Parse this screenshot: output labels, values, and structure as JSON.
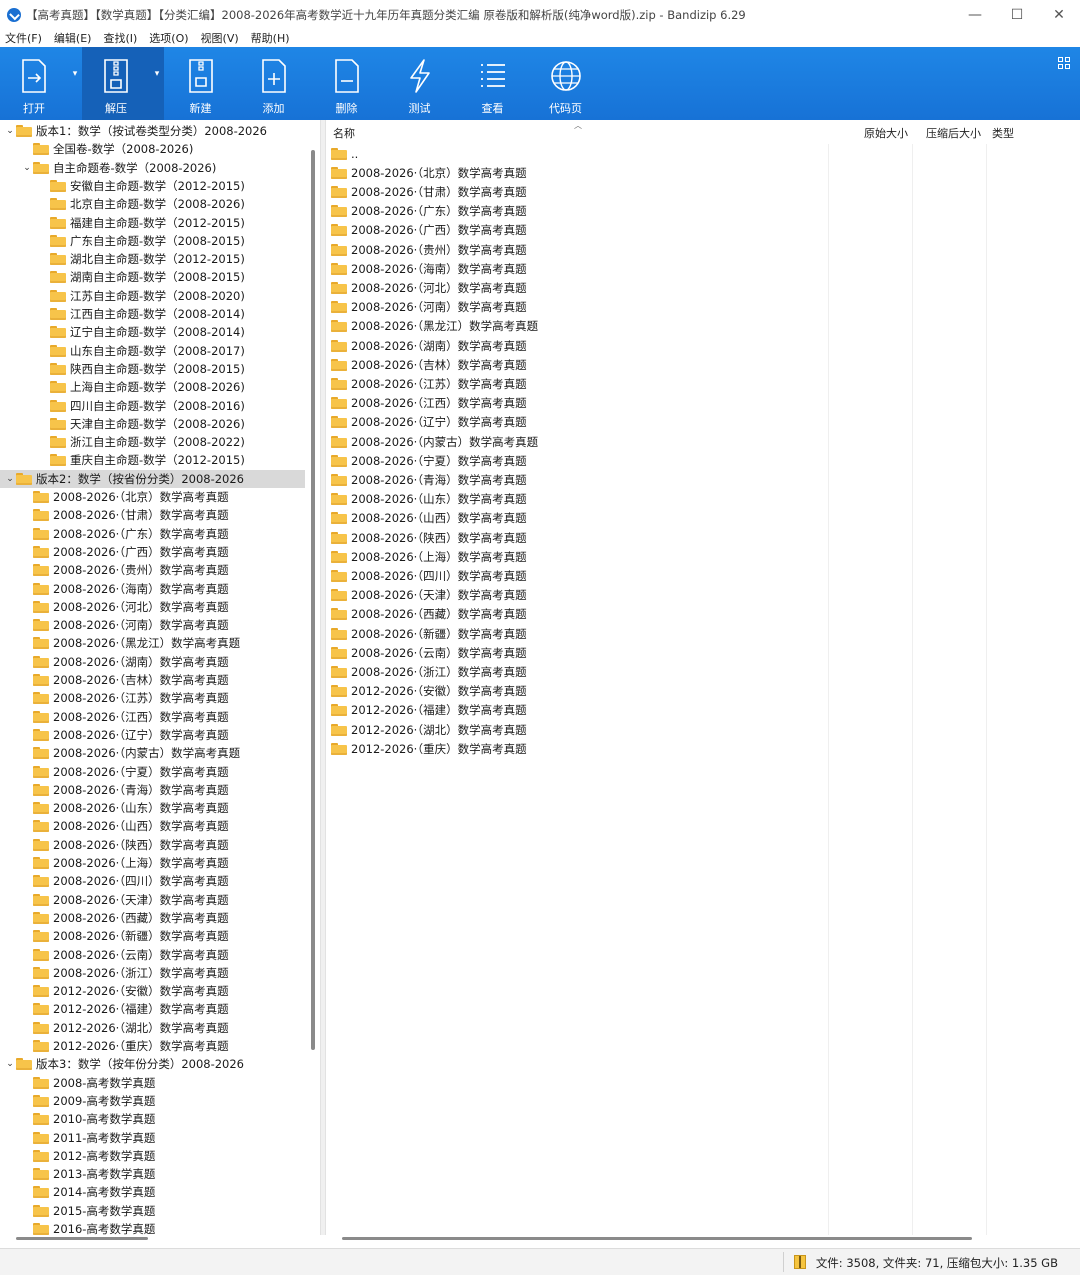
{
  "window": {
    "title": "【高考真题】【数学真题】【分类汇编】2008-2026年高考数学近十九年历年真题分类汇编   原卷版和解析版(纯净word版).zip - Bandizip 6.29",
    "minimize": "—",
    "maximize": "☐",
    "close": "✕"
  },
  "menu": [
    "文件(F)",
    "编辑(E)",
    "查找(I)",
    "选项(O)",
    "视图(V)",
    "帮助(H)"
  ],
  "toolbar": {
    "open": "打开",
    "extract": "解压",
    "new": "新建",
    "add": "添加",
    "delete": "删除",
    "test": "测试",
    "view": "查看",
    "codepage": "代码页"
  },
  "tree": [
    {
      "level": 0,
      "twisty": "expanded",
      "label": "版本1：数学（按试卷类型分类）2008-2026"
    },
    {
      "level": 1,
      "twisty": "none",
      "label": "全国卷-数学（2008-2026)"
    },
    {
      "level": 1,
      "twisty": "expanded",
      "label": "自主命题卷-数学（2008-2026)"
    },
    {
      "level": 2,
      "twisty": "none",
      "label": "安徽自主命题-数学（2012-2015)"
    },
    {
      "level": 2,
      "twisty": "none",
      "label": "北京自主命题-数学（2008-2026)"
    },
    {
      "level": 2,
      "twisty": "none",
      "label": "福建自主命题-数学（2012-2015)"
    },
    {
      "level": 2,
      "twisty": "none",
      "label": "广东自主命题-数学（2008-2015)"
    },
    {
      "level": 2,
      "twisty": "none",
      "label": "湖北自主命题-数学（2012-2015)"
    },
    {
      "level": 2,
      "twisty": "none",
      "label": "湖南自主命题-数学（2008-2015)"
    },
    {
      "level": 2,
      "twisty": "none",
      "label": "江苏自主命题-数学（2008-2020)"
    },
    {
      "level": 2,
      "twisty": "none",
      "label": "江西自主命题-数学（2008-2014)"
    },
    {
      "level": 2,
      "twisty": "none",
      "label": "辽宁自主命题-数学（2008-2014)"
    },
    {
      "level": 2,
      "twisty": "none",
      "label": "山东自主命题-数学（2008-2017)"
    },
    {
      "level": 2,
      "twisty": "none",
      "label": "陕西自主命题-数学（2008-2015)"
    },
    {
      "level": 2,
      "twisty": "none",
      "label": "上海自主命题-数学（2008-2026)"
    },
    {
      "level": 2,
      "twisty": "none",
      "label": "四川自主命题-数学（2008-2016)"
    },
    {
      "level": 2,
      "twisty": "none",
      "label": "天津自主命题-数学（2008-2026)"
    },
    {
      "level": 2,
      "twisty": "none",
      "label": "浙江自主命题-数学（2008-2022)"
    },
    {
      "level": 2,
      "twisty": "none",
      "label": "重庆自主命题-数学（2012-2015)"
    },
    {
      "level": 0,
      "twisty": "expanded",
      "label": "版本2：数学（按省份分类）2008-2026",
      "selected": true
    },
    {
      "level": 1,
      "twisty": "none",
      "label": "2008-2026·（北京）数学高考真题"
    },
    {
      "level": 1,
      "twisty": "none",
      "label": "2008-2026·（甘肃）数学高考真题"
    },
    {
      "level": 1,
      "twisty": "none",
      "label": "2008-2026·（广东）数学高考真题"
    },
    {
      "level": 1,
      "twisty": "none",
      "label": "2008-2026·（广西）数学高考真题"
    },
    {
      "level": 1,
      "twisty": "none",
      "label": "2008-2026·（贵州）数学高考真题"
    },
    {
      "level": 1,
      "twisty": "none",
      "label": "2008-2026·（海南）数学高考真题"
    },
    {
      "level": 1,
      "twisty": "none",
      "label": "2008-2026·（河北）数学高考真题"
    },
    {
      "level": 1,
      "twisty": "none",
      "label": "2008-2026·（河南）数学高考真题"
    },
    {
      "level": 1,
      "twisty": "none",
      "label": "2008-2026·（黑龙江）数学高考真题"
    },
    {
      "level": 1,
      "twisty": "none",
      "label": "2008-2026·（湖南）数学高考真题"
    },
    {
      "level": 1,
      "twisty": "none",
      "label": "2008-2026·（吉林）数学高考真题"
    },
    {
      "level": 1,
      "twisty": "none",
      "label": "2008-2026·（江苏）数学高考真题"
    },
    {
      "level": 1,
      "twisty": "none",
      "label": "2008-2026·（江西）数学高考真题"
    },
    {
      "level": 1,
      "twisty": "none",
      "label": "2008-2026·（辽宁）数学高考真题"
    },
    {
      "level": 1,
      "twisty": "none",
      "label": "2008-2026·（内蒙古）数学高考真题"
    },
    {
      "level": 1,
      "twisty": "none",
      "label": "2008-2026·（宁夏）数学高考真题"
    },
    {
      "level": 1,
      "twisty": "none",
      "label": "2008-2026·（青海）数学高考真题"
    },
    {
      "level": 1,
      "twisty": "none",
      "label": "2008-2026·（山东）数学高考真题"
    },
    {
      "level": 1,
      "twisty": "none",
      "label": "2008-2026·（山西）数学高考真题"
    },
    {
      "level": 1,
      "twisty": "none",
      "label": "2008-2026·（陕西）数学高考真题"
    },
    {
      "level": 1,
      "twisty": "none",
      "label": "2008-2026·（上海）数学高考真题"
    },
    {
      "level": 1,
      "twisty": "none",
      "label": "2008-2026·（四川）数学高考真题"
    },
    {
      "level": 1,
      "twisty": "none",
      "label": "2008-2026·（天津）数学高考真题"
    },
    {
      "level": 1,
      "twisty": "none",
      "label": "2008-2026·（西藏）数学高考真题"
    },
    {
      "level": 1,
      "twisty": "none",
      "label": "2008-2026·（新疆）数学高考真题"
    },
    {
      "level": 1,
      "twisty": "none",
      "label": "2008-2026·（云南）数学高考真题"
    },
    {
      "level": 1,
      "twisty": "none",
      "label": "2008-2026·（浙江）数学高考真题"
    },
    {
      "level": 1,
      "twisty": "none",
      "label": "2012-2026·（安徽）数学高考真题"
    },
    {
      "level": 1,
      "twisty": "none",
      "label": "2012-2026·（福建）数学高考真题"
    },
    {
      "level": 1,
      "twisty": "none",
      "label": "2012-2026·（湖北）数学高考真题"
    },
    {
      "level": 1,
      "twisty": "none",
      "label": "2012-2026·（重庆）数学高考真题"
    },
    {
      "level": 0,
      "twisty": "expanded",
      "label": "版本3：数学（按年份分类）2008-2026"
    },
    {
      "level": 1,
      "twisty": "none",
      "label": "2008-高考数学真题"
    },
    {
      "level": 1,
      "twisty": "none",
      "label": "2009-高考数学真题"
    },
    {
      "level": 1,
      "twisty": "none",
      "label": "2010-高考数学真题"
    },
    {
      "level": 1,
      "twisty": "none",
      "label": "2011-高考数学真题"
    },
    {
      "level": 1,
      "twisty": "none",
      "label": "2012-高考数学真题"
    },
    {
      "level": 1,
      "twisty": "none",
      "label": "2013-高考数学真题"
    },
    {
      "level": 1,
      "twisty": "none",
      "label": "2014-高考数学真题"
    },
    {
      "level": 1,
      "twisty": "none",
      "label": "2015-高考数学真题"
    },
    {
      "level": 1,
      "twisty": "none",
      "label": "2016-高考数学真题"
    }
  ],
  "list": {
    "columns": {
      "name": "名称",
      "original_size": "原始大小",
      "compressed_size": "压缩后大小",
      "type": "类型"
    },
    "items": [
      "..",
      "2008-2026·（北京）数学高考真题",
      "2008-2026·（甘肃）数学高考真题",
      "2008-2026·（广东）数学高考真题",
      "2008-2026·（广西）数学高考真题",
      "2008-2026·（贵州）数学高考真题",
      "2008-2026·（海南）数学高考真题",
      "2008-2026·（河北）数学高考真题",
      "2008-2026·（河南）数学高考真题",
      "2008-2026·（黑龙江）数学高考真题",
      "2008-2026·（湖南）数学高考真题",
      "2008-2026·（吉林）数学高考真题",
      "2008-2026·（江苏）数学高考真题",
      "2008-2026·（江西）数学高考真题",
      "2008-2026·（辽宁）数学高考真题",
      "2008-2026·（内蒙古）数学高考真题",
      "2008-2026·（宁夏）数学高考真题",
      "2008-2026·（青海）数学高考真题",
      "2008-2026·（山东）数学高考真题",
      "2008-2026·（山西）数学高考真题",
      "2008-2026·（陕西）数学高考真题",
      "2008-2026·（上海）数学高考真题",
      "2008-2026·（四川）数学高考真题",
      "2008-2026·（天津）数学高考真题",
      "2008-2026·（西藏）数学高考真题",
      "2008-2026·（新疆）数学高考真题",
      "2008-2026·（云南）数学高考真题",
      "2008-2026·（浙江）数学高考真题",
      "2012-2026·（安徽）数学高考真题",
      "2012-2026·（福建）数学高考真题",
      "2012-2026·（湖北）数学高考真题",
      "2012-2026·（重庆）数学高考真题"
    ]
  },
  "status": {
    "text": "文件: 3508, 文件夹: 71, 压缩包大小: 1.35 GB"
  },
  "colors": {
    "toolbar": "#1f86e6",
    "toolbar_active": "#1561b8",
    "folder": "#f7c44a",
    "selected_row": "#d9d9d9"
  }
}
